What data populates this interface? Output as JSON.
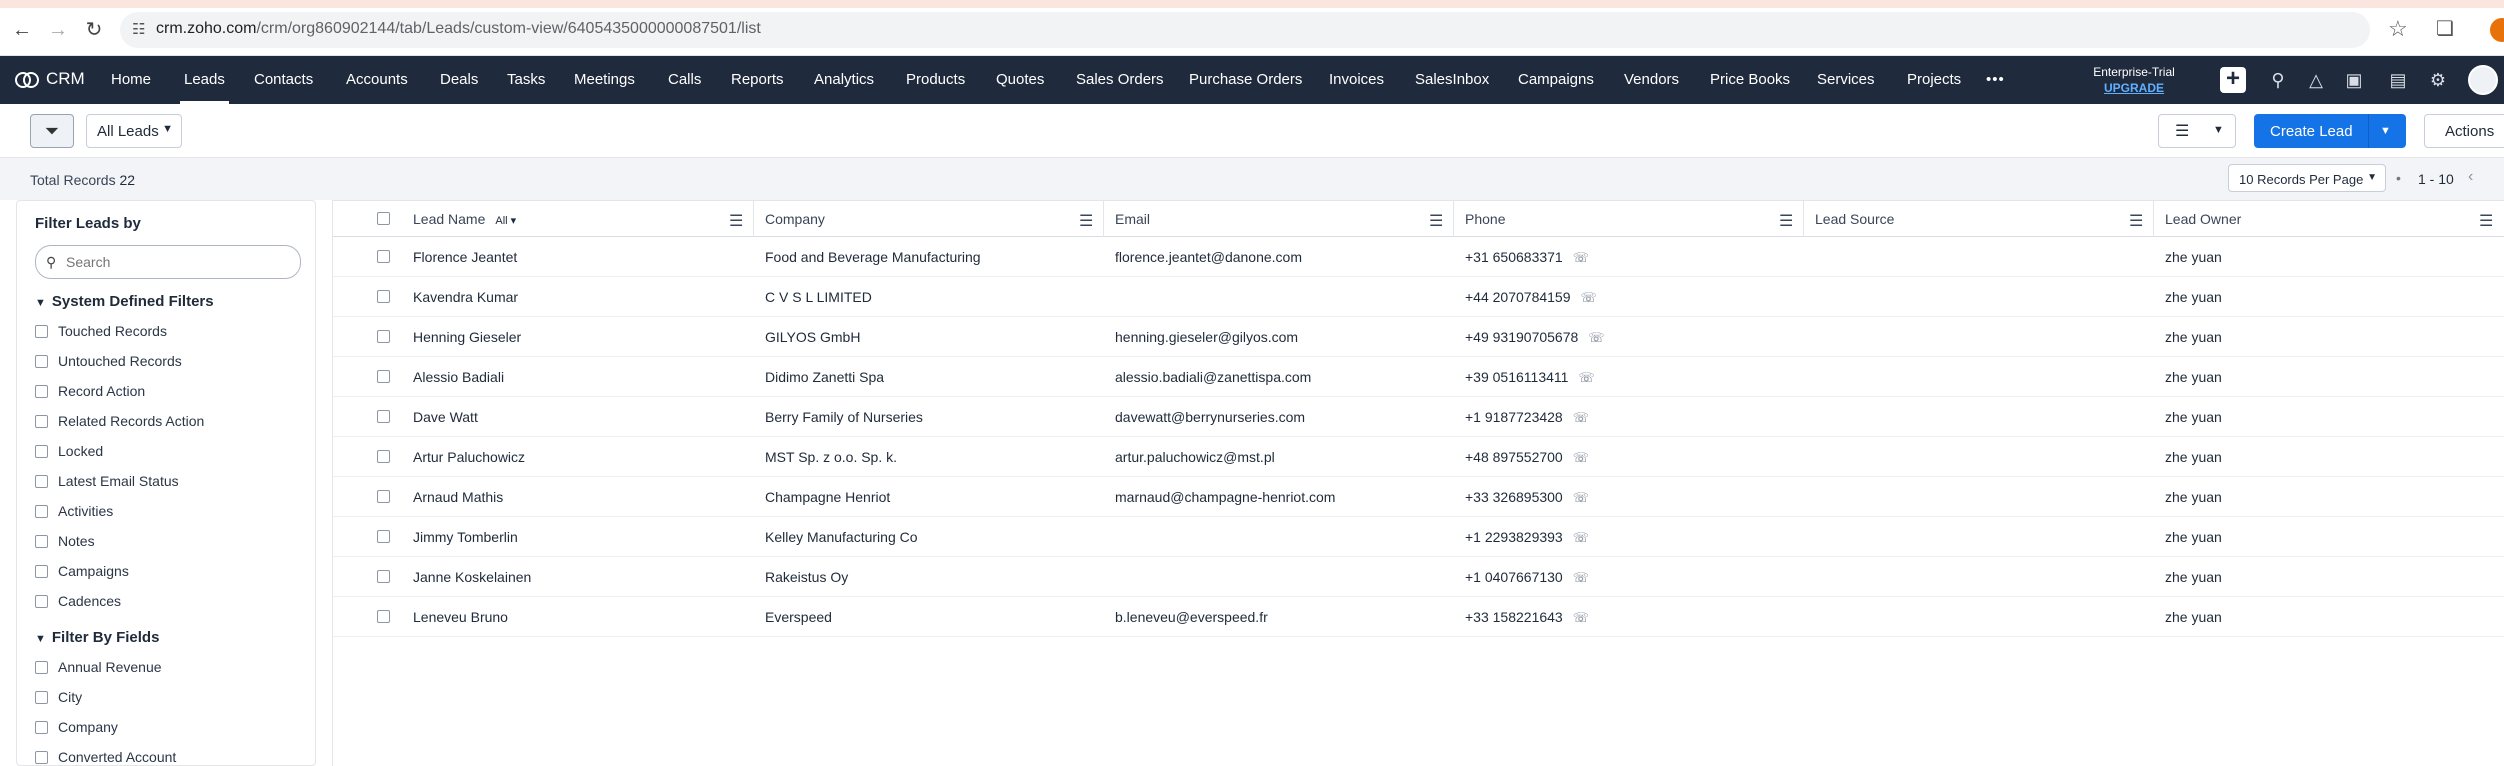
{
  "browser": {
    "url_host": "crm.zoho.com",
    "url_path": "/crm/org860902144/tab/Leads/custom-view/6405435000000087501/list"
  },
  "topnav": {
    "app_name": "CRM",
    "items": [
      "Home",
      "Leads",
      "Contacts",
      "Accounts",
      "Deals",
      "Tasks",
      "Meetings",
      "Calls",
      "Reports",
      "Analytics",
      "Products",
      "Quotes",
      "Sales Orders",
      "Purchase Orders",
      "Invoices",
      "SalesInbox",
      "Campaigns",
      "Vendors",
      "Price Books",
      "Services",
      "Projects"
    ],
    "active_item": "Leads",
    "more_label": "•••",
    "plan_label": "Enterprise-Trial",
    "upgrade_label": "UPGRADE",
    "icons": [
      "plus-icon",
      "search-icon",
      "bell-icon",
      "calendar-icon",
      "store-icon",
      "gear-icon",
      "avatar"
    ]
  },
  "toolbar": {
    "view_selector": "All Leads",
    "create_label": "Create Lead",
    "actions_label": "Actions"
  },
  "subbar": {
    "total_label": "Total Records",
    "total_count": "22",
    "per_page": "10 Records Per Page",
    "page_range": "1 - 10"
  },
  "filters": {
    "title": "Filter Leads by",
    "search_placeholder": "Search",
    "system_section": "System Defined Filters",
    "system_items": [
      "Touched Records",
      "Untouched Records",
      "Record Action",
      "Related Records Action",
      "Locked",
      "Latest Email Status",
      "Activities",
      "Notes",
      "Campaigns",
      "Cadences"
    ],
    "fields_section": "Filter By Fields",
    "field_items": [
      "Annual Revenue",
      "City",
      "Company",
      "Converted Account"
    ]
  },
  "table": {
    "columns": [
      "Lead Name",
      "Company",
      "Email",
      "Phone",
      "Lead Source",
      "Lead Owner"
    ],
    "lead_name_filter": "All",
    "rows": [
      {
        "name": "Florence Jeantet",
        "company": "Food and Beverage Manufacturing",
        "email": "florence.jeantet@danone.com",
        "phone": "+31 650683371",
        "source": "",
        "owner": "zhe yuan"
      },
      {
        "name": "Kavendra Kumar",
        "company": "C V S L LIMITED",
        "email": "",
        "phone": "+44 2070784159",
        "source": "",
        "owner": "zhe yuan"
      },
      {
        "name": "Henning Gieseler",
        "company": "GILYOS GmbH",
        "email": "henning.gieseler@gilyos.com",
        "phone": "+49 93190705678",
        "source": "",
        "owner": "zhe yuan"
      },
      {
        "name": "Alessio Badiali",
        "company": "Didimo Zanetti Spa",
        "email": "alessio.badiali@zanettispa.com",
        "phone": "+39 0516113411",
        "source": "",
        "owner": "zhe yuan"
      },
      {
        "name": "Dave Watt",
        "company": "Berry Family of Nurseries",
        "email": "davewatt@berrynurseries.com",
        "phone": "+1 9187723428",
        "source": "",
        "owner": "zhe yuan"
      },
      {
        "name": "Artur Paluchowicz",
        "company": "MST Sp. z o.o. Sp. k.",
        "email": "artur.paluchowicz@mst.pl",
        "phone": "+48 897552700",
        "source": "",
        "owner": "zhe yuan"
      },
      {
        "name": "Arnaud Mathis",
        "company": "Champagne Henriot",
        "email": "marnaud@champagne-henriot.com",
        "phone": "+33 326895300",
        "source": "",
        "owner": "zhe yuan"
      },
      {
        "name": "Jimmy Tomberlin",
        "company": "Kelley Manufacturing Co",
        "email": "",
        "phone": "+1 2293829393",
        "source": "",
        "owner": "zhe yuan"
      },
      {
        "name": "Janne Koskelainen",
        "company": "Rakeistus Oy",
        "email": "",
        "phone": "+1 0407667130",
        "source": "",
        "owner": "zhe yuan"
      },
      {
        "name": "Leneveu Bruno",
        "company": "Everspeed",
        "email": "b.leneveu@everspeed.fr",
        "phone": "+33 158221643",
        "source": "",
        "owner": "zhe yuan"
      }
    ]
  },
  "colors": {
    "nav_bg": "#1f2a3d",
    "primary": "#1473e6",
    "upgrade": "#5fb1ff"
  }
}
